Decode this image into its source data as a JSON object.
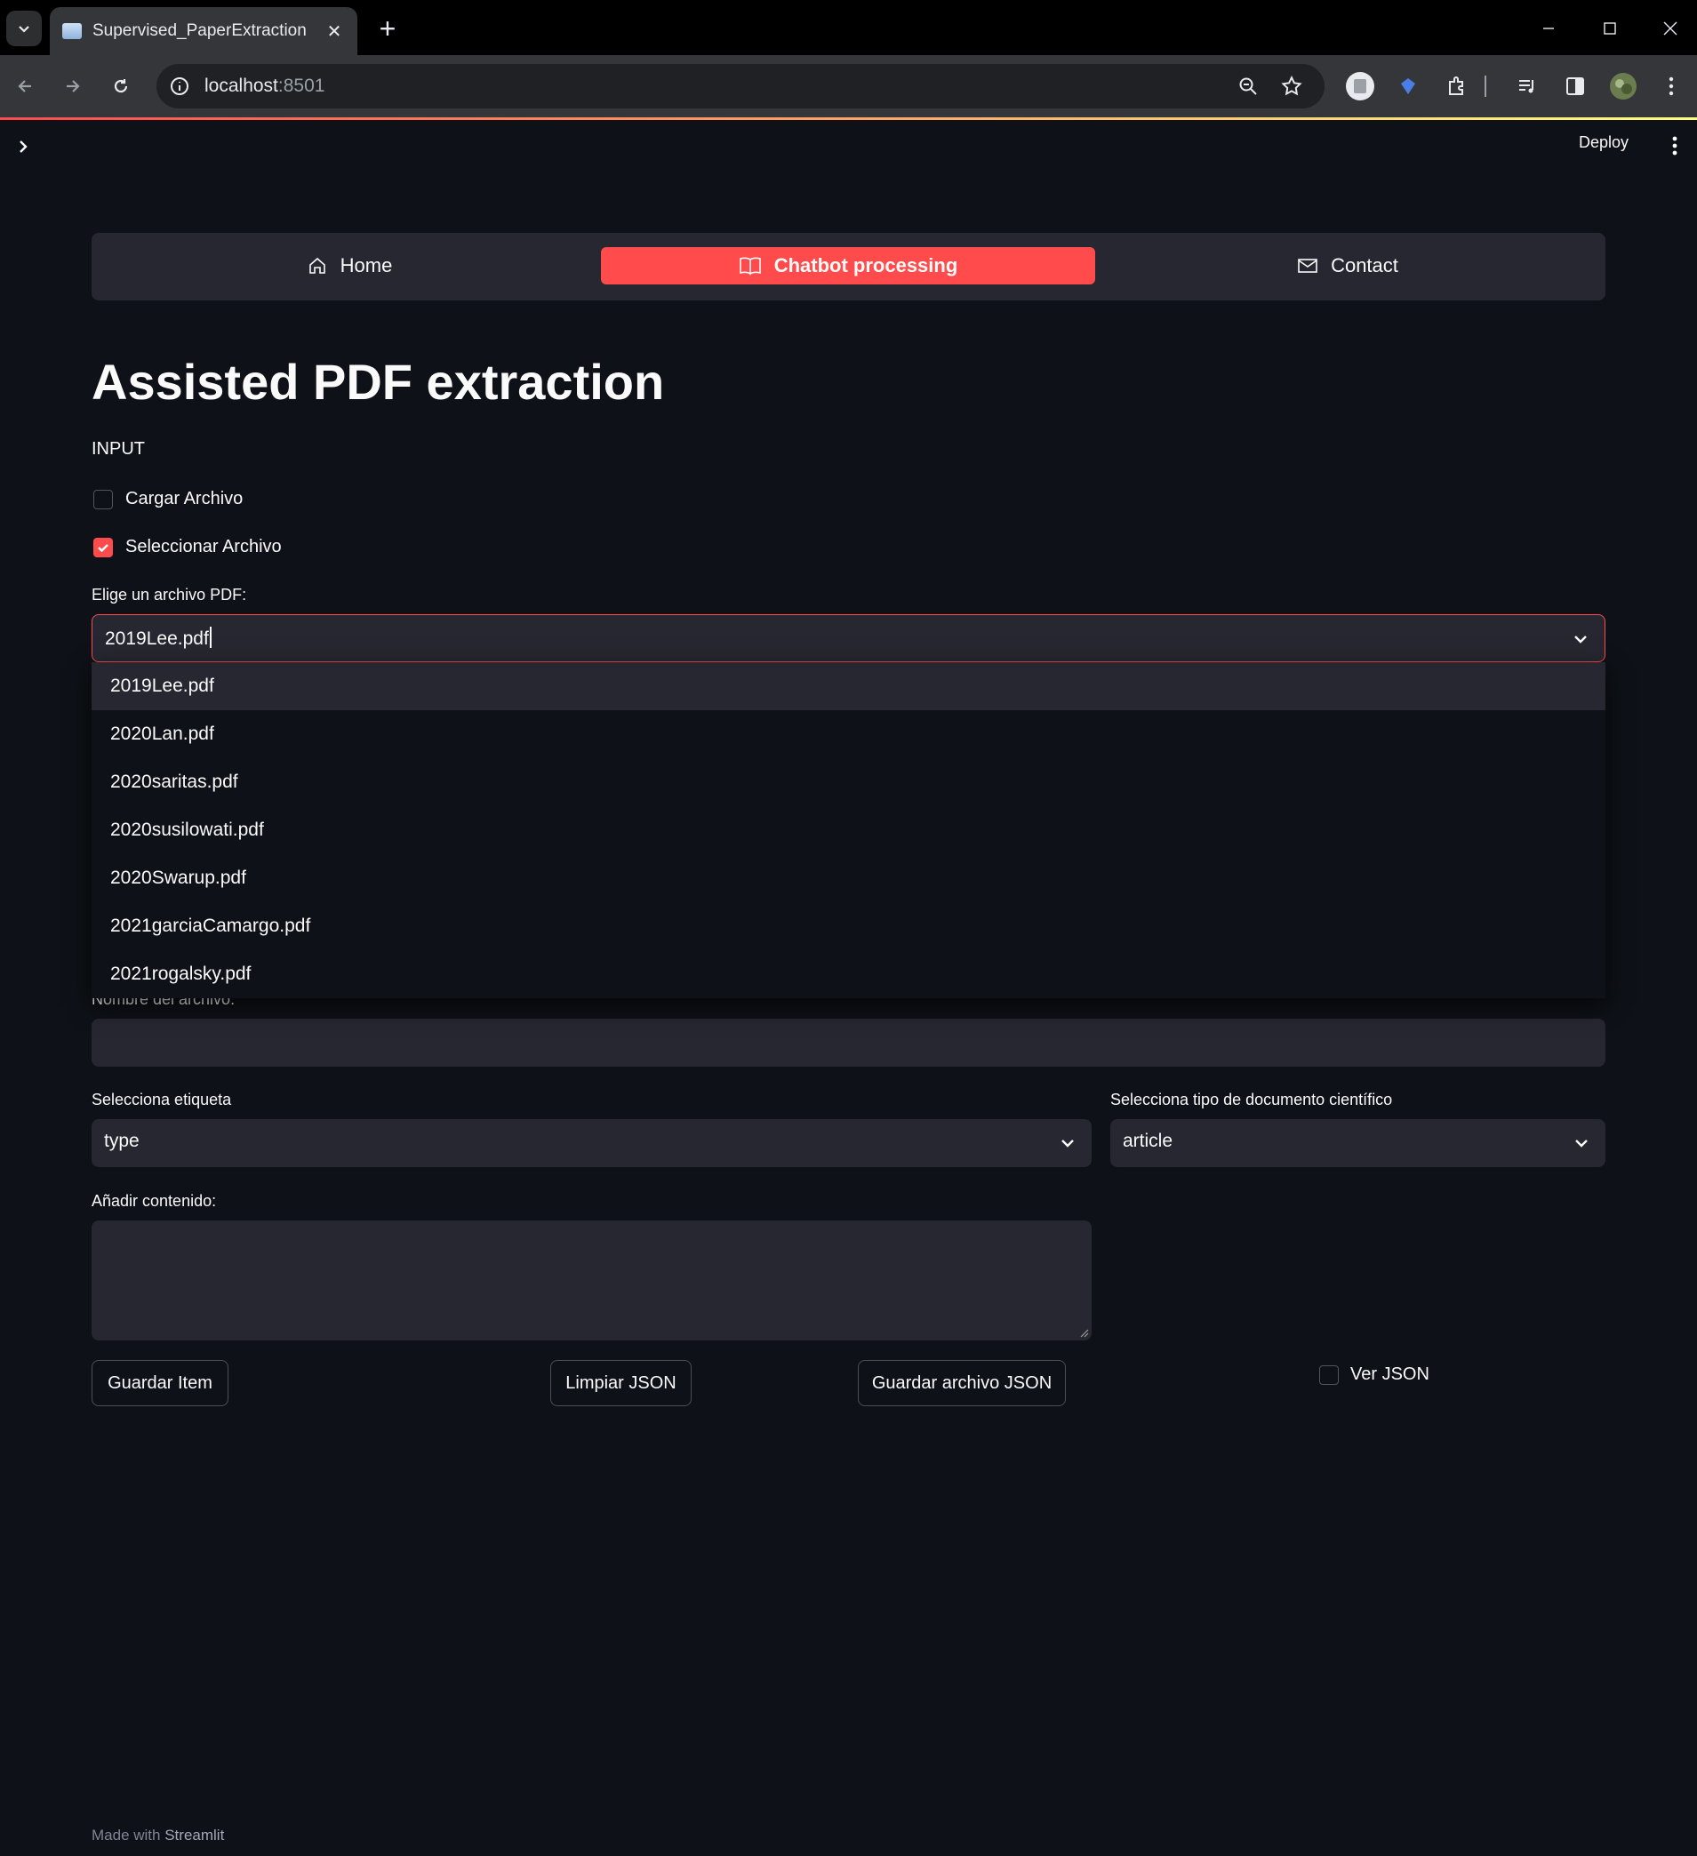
{
  "browser": {
    "tab_title": "Supervised_PaperExtraction",
    "url_host": "localhost",
    "url_port": ":8501"
  },
  "header": {
    "deploy_label": "Deploy"
  },
  "nav": {
    "items": [
      {
        "label": "Home",
        "icon": "house-icon"
      },
      {
        "label": "Chatbot processing",
        "icon": "book-icon",
        "active": true
      },
      {
        "label": "Contact",
        "icon": "envelope-icon"
      }
    ]
  },
  "main": {
    "title": "Assisted PDF extraction",
    "section_label": "INPUT",
    "checkbox_cargar": {
      "label": "Cargar Archivo",
      "checked": false
    },
    "checkbox_seleccionar": {
      "label": "Seleccionar Archivo",
      "checked": true
    },
    "pdf_select": {
      "label": "Elige un archivo PDF:",
      "value": "2019Lee.pdf",
      "options": [
        "2019Lee.pdf",
        "2020Lan.pdf",
        "2020saritas.pdf",
        "2020susilowati.pdf",
        "2020Swarup.pdf",
        "2021garciaCamargo.pdf",
        "2021rogalsky.pdf"
      ]
    },
    "filename": {
      "label": "Nombre del archivo:",
      "value": ""
    },
    "tag_select": {
      "label": "Selecciona etiqueta",
      "value": "type"
    },
    "doctype_select": {
      "label": "Selecciona tipo de documento científico",
      "value": "article"
    },
    "content": {
      "label": "Añadir contenido:",
      "value": ""
    },
    "buttons": {
      "save_item": "Guardar Item",
      "clear_json": "Limpiar JSON",
      "save_json_file": "Guardar archivo JSON"
    },
    "checkbox_ver_json": {
      "label": "Ver JSON",
      "checked": false
    }
  },
  "footer": {
    "made_with": "Made with",
    "brand": "Streamlit"
  },
  "colors": {
    "accent": "#ff4b4b",
    "background": "#0e1117",
    "widget_bg": "#262730"
  }
}
